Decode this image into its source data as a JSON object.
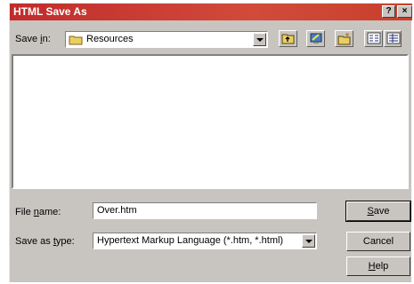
{
  "dialog": {
    "title": "HTML Save As",
    "help_button": "?",
    "close_button": "×"
  },
  "save_in": {
    "label": "Save in:",
    "accesskey": "i",
    "label_rest": "n:",
    "label_prefix": "Save ",
    "value": "Resources"
  },
  "toolbar": {
    "up_folder_icon": "up-one-level-icon",
    "desktop_icon": "desktop-icon",
    "new_folder_icon": "create-new-folder-icon",
    "list_view_icon": "list-view-icon",
    "details_view_icon": "details-view-icon"
  },
  "file_name": {
    "label_prefix": "File ",
    "accesskey": "n",
    "label_rest": "ame:",
    "value": "Over.htm"
  },
  "save_as_type": {
    "label_prefix": "Save as ",
    "accesskey": "t",
    "label_rest": "ype:",
    "value": "Hypertext Markup Language (*.htm, *.html)"
  },
  "buttons": {
    "save_key": "S",
    "save_rest": "ave",
    "cancel": "Cancel",
    "help_key": "H",
    "help_rest": "elp"
  }
}
